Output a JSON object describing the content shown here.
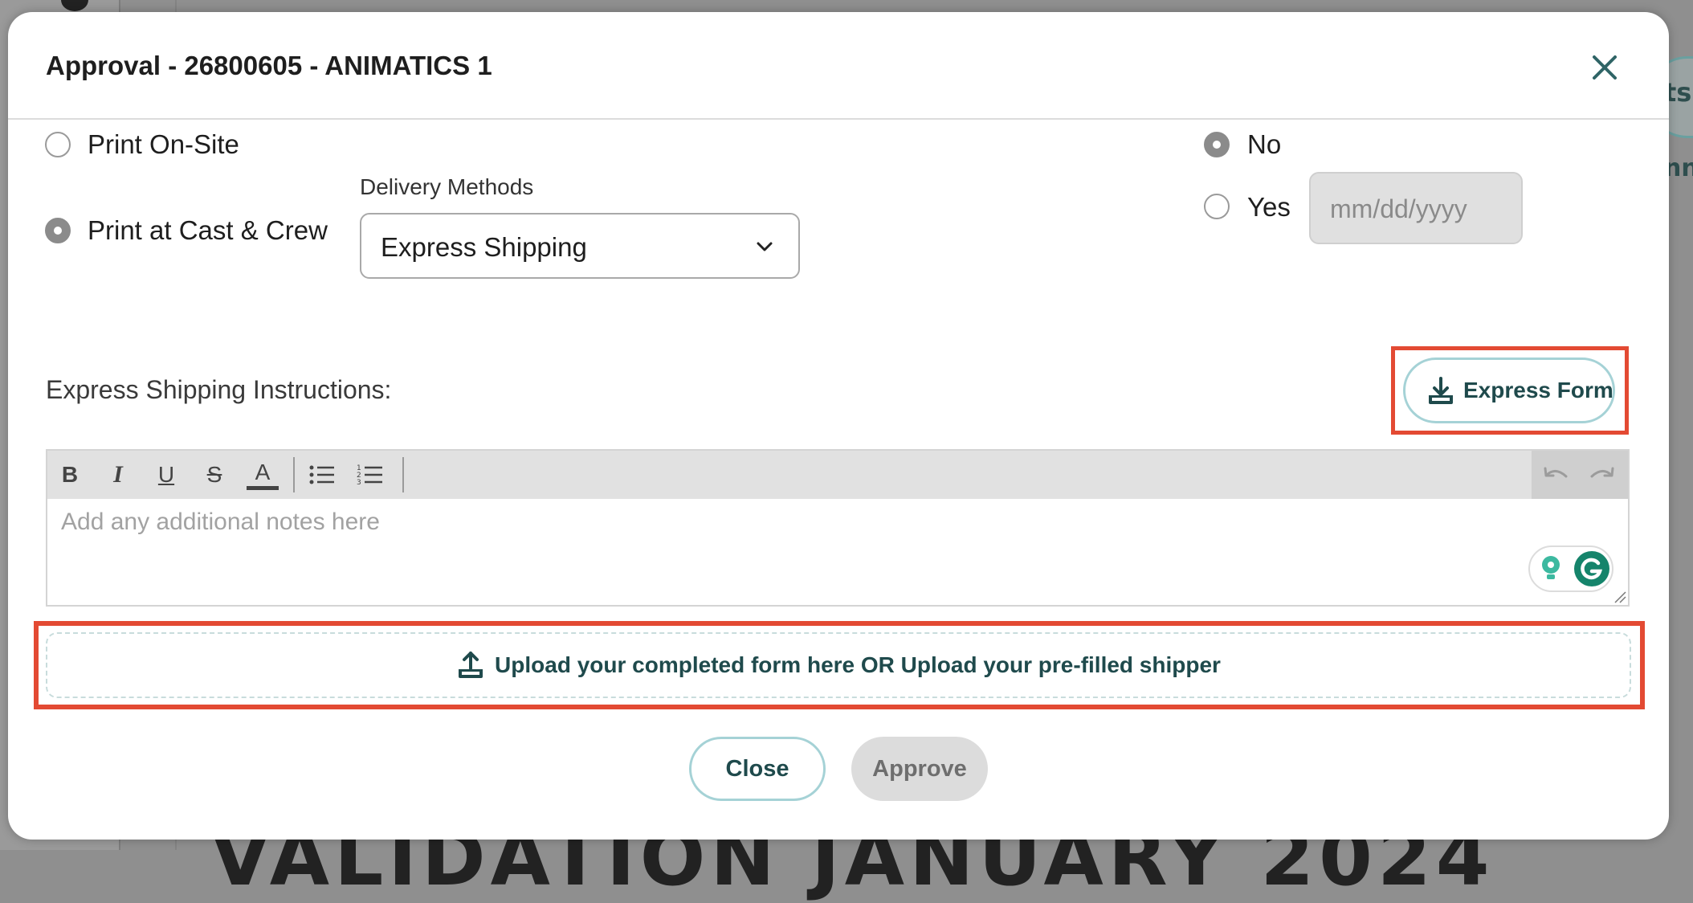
{
  "modal": {
    "title": "Approval - 26800605 - ANIMATICS 1"
  },
  "print_options": {
    "on_site_label": "Print On-Site",
    "on_site_selected": false,
    "cast_crew_label": "Print at Cast & Crew",
    "cast_crew_selected": true
  },
  "delivery": {
    "label": "Delivery Methods",
    "selected": "Express Shipping"
  },
  "date_choice": {
    "no_label": "No",
    "no_selected": true,
    "yes_label": "Yes",
    "yes_selected": false,
    "date_placeholder": "mm/dd/yyyy"
  },
  "instructions": {
    "label": "Express Shipping Instructions:",
    "express_form_button": "Express Form",
    "editor_placeholder": "Add any additional notes here",
    "toolbar": {
      "bold": "B",
      "italic": "I",
      "underline": "U",
      "strike": "S",
      "font_color": "A"
    }
  },
  "upload": {
    "label": "Upload your completed form here OR Upload your pre-filled shipper"
  },
  "footer": {
    "close_label": "Close",
    "approve_label": "Approve"
  },
  "background": {
    "partial_right_top": "ts",
    "partial_right_bottom": "nn",
    "partial_bottom_text": "VALIDATION JANUARY 2024"
  },
  "colors": {
    "accent_dark": "#1f4a4c",
    "accent_border": "#a5d2d6",
    "highlight": "#e34a33",
    "disabled_bg": "#dcdcdc"
  }
}
